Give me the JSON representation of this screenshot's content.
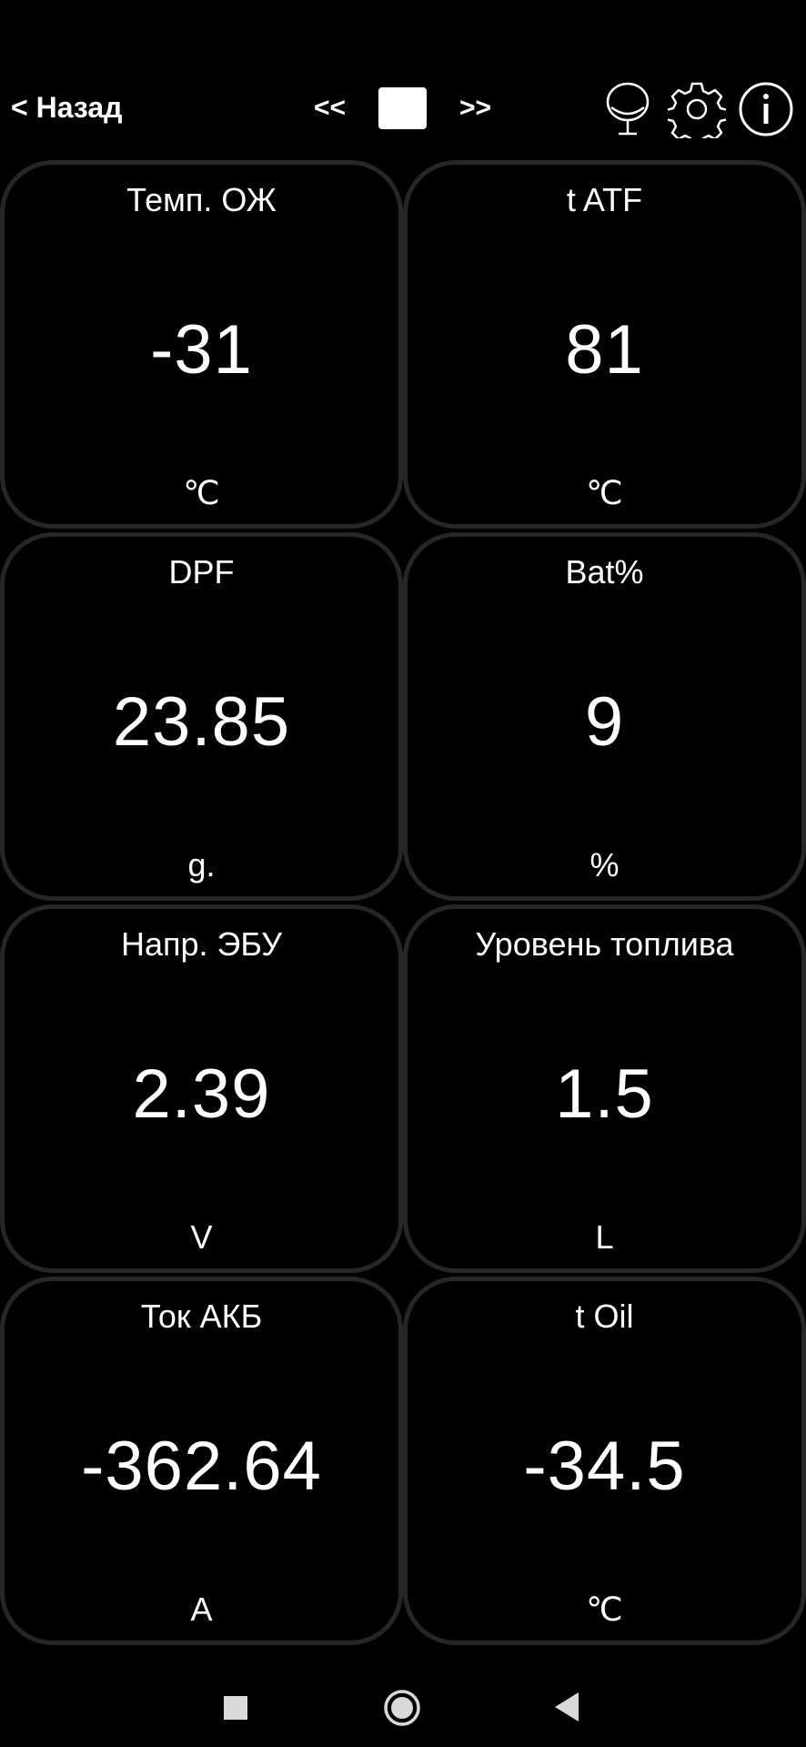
{
  "header": {
    "back_label": "< Назад",
    "prev_label": "<<",
    "next_label": ">>"
  },
  "icons": {
    "mic": "microphone-icon",
    "settings": "gear-icon",
    "info": "info-icon"
  },
  "cards": [
    {
      "label": "Темп. ОЖ",
      "value": "-31",
      "unit": "℃"
    },
    {
      "label": "t ATF",
      "value": "81",
      "unit": "℃"
    },
    {
      "label": "DPF",
      "value": "23.85",
      "unit": "g."
    },
    {
      "label": "Bat%",
      "value": "9",
      "unit": "%"
    },
    {
      "label": "Напр. ЭБУ",
      "value": "2.39",
      "unit": "V"
    },
    {
      "label": "Уровень топлива",
      "value": "1.5",
      "unit": "L"
    },
    {
      "label": "Ток АКБ",
      "value": "-362.64",
      "unit": "A"
    },
    {
      "label": "t Oil",
      "value": "-34.5",
      "unit": "℃"
    }
  ],
  "colors": {
    "background": "#000000",
    "card_border": "#262626",
    "text": "#ffffff"
  }
}
